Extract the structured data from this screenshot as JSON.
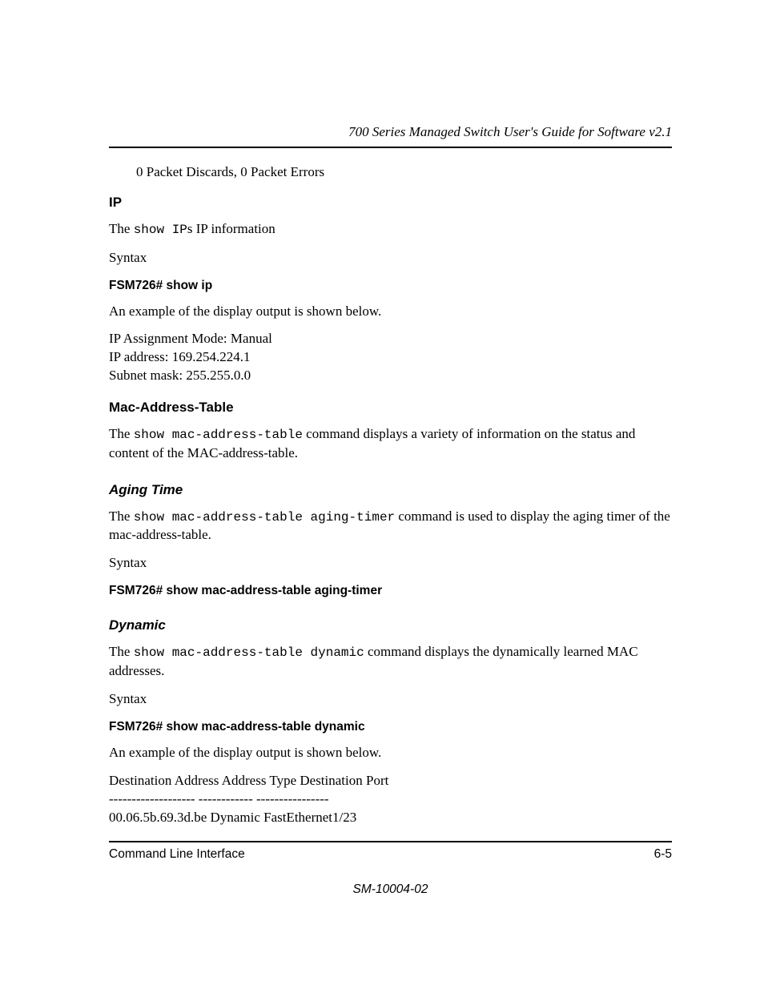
{
  "header": {
    "title": "700 Series Managed Switch User's Guide for Software v2.1"
  },
  "top_indent_line": "0 Packet Discards, 0 Packet Errors",
  "ip": {
    "heading": "IP",
    "desc_pre": "The ",
    "desc_code": "show IP",
    "desc_post": "s IP information",
    "syntax": "Syntax",
    "cmd": "FSM726# show ip",
    "example_intro": "An example of the display output is shown below.",
    "out1": "IP Assignment Mode: Manual",
    "out2": "IP address: 169.254.224.1",
    "out3": "Subnet mask: 255.255.0.0"
  },
  "mac": {
    "heading": "Mac-Address-Table",
    "desc_pre": "The ",
    "desc_code": "show mac-address-table",
    "desc_post": " command displays a variety of information on the status and content of the MAC-address-table."
  },
  "aging": {
    "heading": "Aging Time",
    "desc_pre": "The ",
    "desc_code": "show mac-address-table aging-timer",
    "desc_post": " command is used to display the aging timer of the mac-address-table.",
    "syntax": "Syntax",
    "cmd": "FSM726# show mac-address-table aging-timer"
  },
  "dynamic": {
    "heading": "Dynamic",
    "desc_pre": "The ",
    "desc_code": "show mac-address-table dynamic",
    "desc_post": " command displays the dynamically learned MAC addresses.",
    "syntax": "Syntax",
    "cmd": "FSM726# show mac-address-table dynamic",
    "example_intro": "An example of the display output is shown below.",
    "table_header": "Destination Address  Address Type  Destination Port",
    "table_sep": "-------------------  ------------  ----------------",
    "table_row": "00.06.5b.69.3d.be      Dynamic       FastEthernet1/23"
  },
  "footer": {
    "left": "Command Line Interface",
    "right": "6-5",
    "center": "SM-10004-02"
  }
}
